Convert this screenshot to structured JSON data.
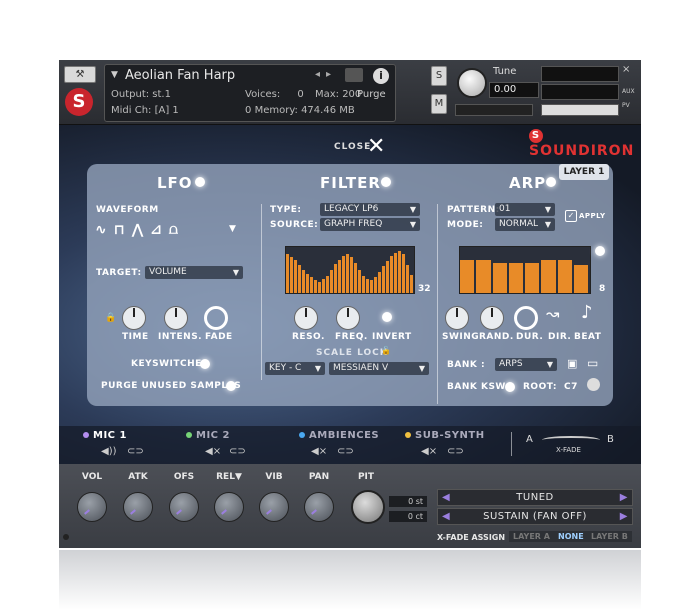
{
  "header": {
    "instrument_name": "Aeolian Fan Harp",
    "output_label": "Output:",
    "output_value": "st.1",
    "voices_label": "Voices:",
    "voices_value": "0",
    "max_label": "Max:",
    "max_value": "200",
    "purge_label": "Purge",
    "midi_label": "Midi Ch:",
    "midi_value": "[A] 1",
    "memory_label": "Memory:",
    "memory_value": "474.46 MB",
    "memory_count": "0",
    "s_button": "S",
    "m_button": "M",
    "tune_label": "Tune",
    "tune_value": "0.00",
    "aux_label": "AUX",
    "pv_label": "PV"
  },
  "brand": {
    "logo": "SOUNDIRON"
  },
  "close_label": "CLOSE",
  "layer_tab": "LAYER 1",
  "lfo": {
    "title": "LFO",
    "waveform_label": "WAVEFORM",
    "target_label": "TARGET:",
    "target_value": "VOLUME",
    "knobs": [
      "TIME",
      "INTENS.",
      "FADE"
    ],
    "keyswitches_label": "KEYSWITCHES",
    "purge_label": "PURGE UNUSED SAMPLES"
  },
  "filter": {
    "title": "FILTER",
    "type_label": "TYPE:",
    "type_value": "LEGACY LP6",
    "source_label": "SOURCE:",
    "source_value": "GRAPH FREQ",
    "graph_steps": "32",
    "graph_values": [
      0.85,
      0.78,
      0.72,
      0.6,
      0.5,
      0.42,
      0.35,
      0.28,
      0.25,
      0.3,
      0.38,
      0.5,
      0.62,
      0.72,
      0.8,
      0.85,
      0.78,
      0.65,
      0.5,
      0.38,
      0.3,
      0.28,
      0.35,
      0.45,
      0.58,
      0.7,
      0.8,
      0.88,
      0.92,
      0.85,
      0.6,
      0.4
    ],
    "knobs": [
      "RESO.",
      "FREQ.",
      "INVERT"
    ],
    "scale_lock_label": "SCALE LOCK",
    "key_value": "KEY - C",
    "scale_value": "MESSIAEN V"
  },
  "arp": {
    "title": "ARP",
    "pattern_label": "PATTERN:",
    "pattern_value": "01",
    "apply_label": "APPLY",
    "mode_label": "MODE:",
    "mode_value": "NORMAL",
    "steps_count": "8",
    "step_values": [
      0.72,
      0.72,
      0.65,
      0.65,
      0.65,
      0.72,
      0.72,
      0.6
    ],
    "knobs": [
      "SWING",
      "RAND.",
      "DUR.",
      "DIR.",
      "BEAT"
    ],
    "bank_label": "BANK :",
    "bank_value": "ARPS",
    "bank_ksw_label": "BANK KSW:",
    "root_label": "ROOT:",
    "root_value": "C7"
  },
  "mics": [
    {
      "name": "MIC 1",
      "color": "#b48ef0"
    },
    {
      "name": "MIC 2",
      "color": "#77d477"
    },
    {
      "name": "AMBIENCES",
      "color": "#4aa8f0"
    },
    {
      "name": "SUB-SYNTH",
      "color": "#f0c040"
    }
  ],
  "xfade": {
    "a": "A",
    "b": "B",
    "label": "X-FADE"
  },
  "bottom": {
    "knobs": [
      "VOL",
      "ATK",
      "OFS",
      "REL",
      "VIB",
      "PAN",
      "PIT"
    ],
    "st_value": "0 st",
    "ct_value": "0 ct",
    "articulation_1": "TUNED",
    "articulation_2": "SUSTAIN (FAN OFF)",
    "xfade_assign_label": "X-FADE ASSIGN",
    "xfade_options": [
      "LAYER A",
      "NONE",
      "LAYER B"
    ],
    "accent_color": "#9b7fe0"
  }
}
